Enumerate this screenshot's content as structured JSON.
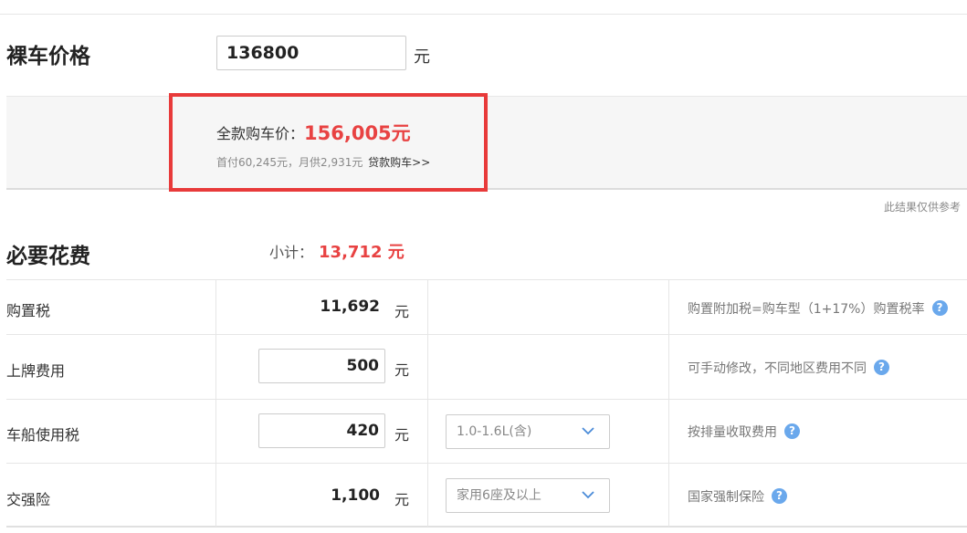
{
  "price_section": {
    "label": "裸车价格",
    "input_value": "136800",
    "unit": "元"
  },
  "summary": {
    "full_label": "全款购车价：",
    "full_value": "156,005元",
    "loan_text": "首付60,245元，月供2,931元",
    "loan_link": "贷款购车>>"
  },
  "disclaimer": "此结果仅供参考",
  "required": {
    "title": "必要花费",
    "subtotal_label": "小计：",
    "subtotal_value": "13,712 元"
  },
  "rows": [
    {
      "label": "购置税",
      "value": "11,692",
      "unit": "元",
      "select": "",
      "note": "购置附加税=购车型（1+17%）购置税率"
    },
    {
      "label": "上牌费用",
      "value": "500",
      "unit": "元",
      "select": "",
      "note": "可手动修改，不同地区费用不同"
    },
    {
      "label": "车船使用税",
      "value": "420",
      "unit": "元",
      "select": "1.0-1.6L(含)",
      "note": "按排量收取费用"
    },
    {
      "label": "交强险",
      "value": "1,100",
      "unit": "元",
      "select": "家用6座及以上",
      "note": "国家强制保险"
    }
  ],
  "help_glyph": "?",
  "colors": {
    "accent_red": "#e84242",
    "highlight_border": "#e83a3a",
    "help_blue": "#6aa8ec"
  }
}
